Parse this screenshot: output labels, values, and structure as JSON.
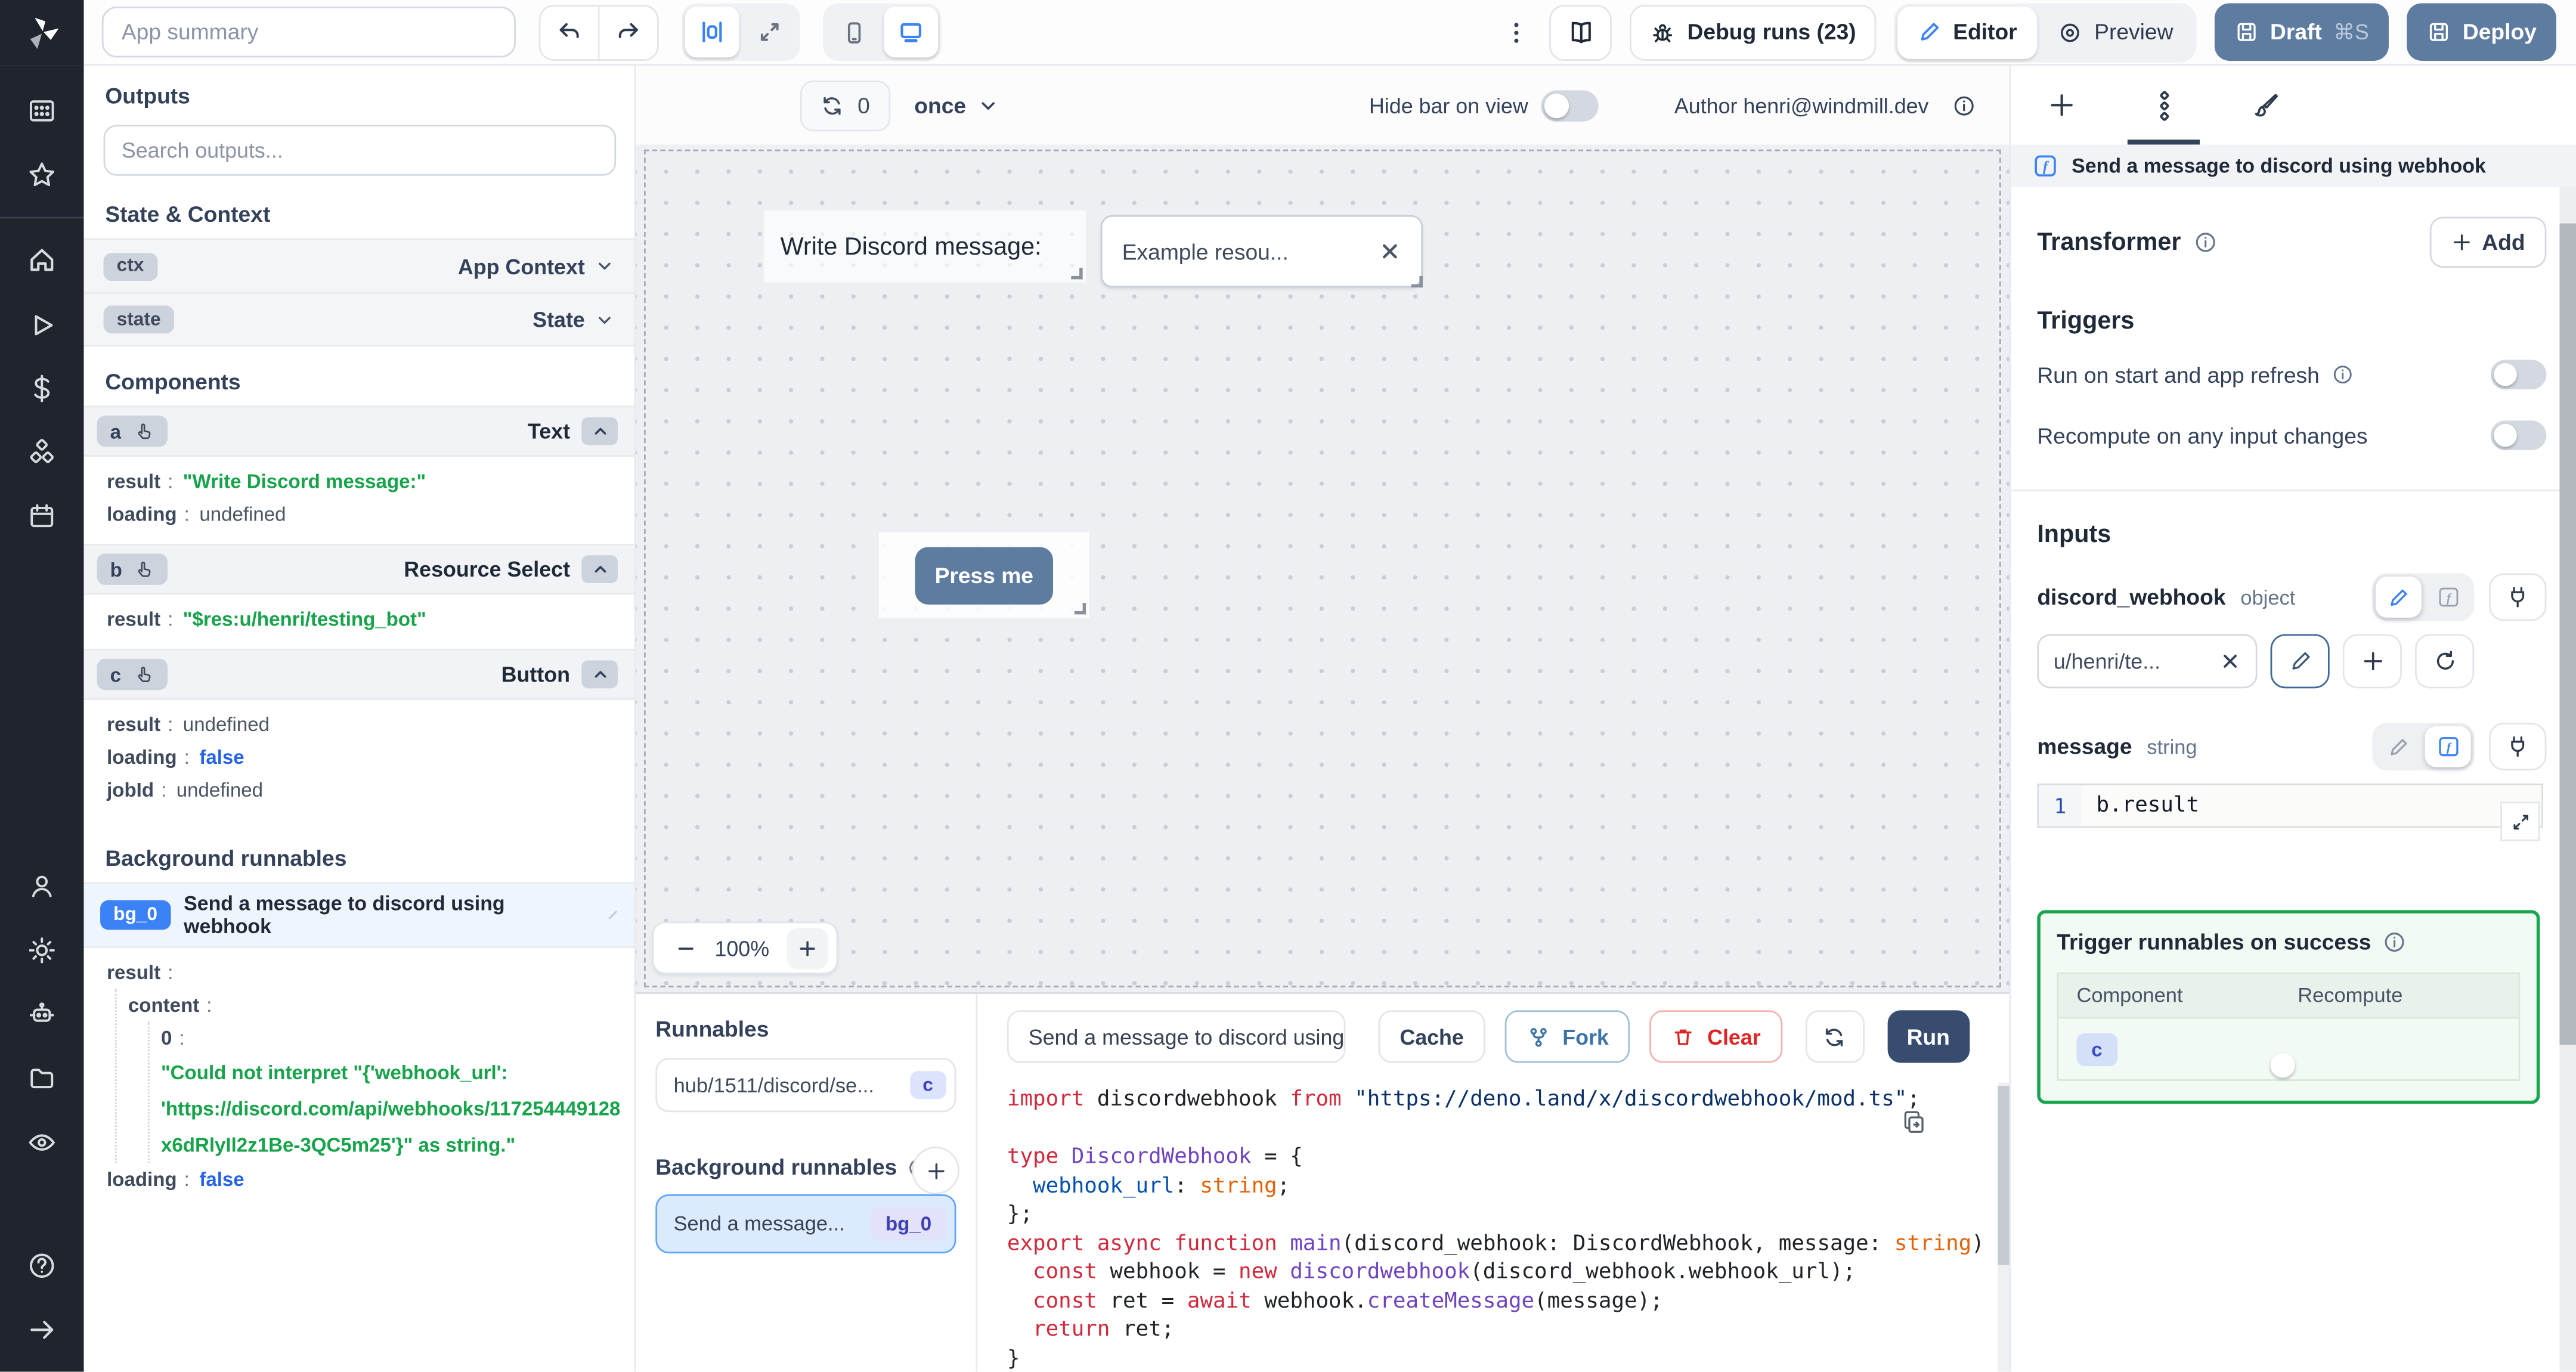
{
  "topbar": {
    "app_summary_placeholder": "App summary",
    "debug_runs_label": "Debug runs (23)",
    "editor_label": "Editor",
    "preview_label": "Preview",
    "draft_label": "Draft",
    "draft_shortcut": "⌘S",
    "deploy_label": "Deploy"
  },
  "outputs_panel": {
    "title": "Outputs",
    "search_placeholder": "Search outputs...",
    "state_context_title": "State & Context",
    "ctx_badge": "ctx",
    "ctx_label": "App Context",
    "state_badge": "state",
    "state_label": "State",
    "components_title": "Components",
    "components": [
      {
        "id": "a",
        "type": "Text",
        "rows": [
          {
            "k": "result",
            "v": "\"Write Discord message:\""
          },
          {
            "k": "loading",
            "v": "undefined"
          }
        ]
      },
      {
        "id": "b",
        "type": "Resource Select",
        "rows": [
          {
            "k": "result",
            "v": "\"$res:u/henri/testing_bot\""
          }
        ]
      },
      {
        "id": "c",
        "type": "Button",
        "rows": [
          {
            "k": "result",
            "v": "undefined"
          },
          {
            "k": "loading",
            "v": "false"
          },
          {
            "k": "jobId",
            "v": "undefined"
          }
        ]
      }
    ],
    "background_title": "Background runnables",
    "bg_badge": "bg_0",
    "bg_title": "Send a message to discord using webhook",
    "bg_result_key": "result",
    "bg_content_key": "content",
    "bg_index_key": "0",
    "bg_error_lines": [
      "\"Could not interpret \"{'webhook_url':",
      "'https://discord.com/api/webhooks/117254449128",
      "x6dRlyIl2z1Be-3QC5m25'}\" as string.\""
    ],
    "bg_loading_key": "loading",
    "bg_loading_value": "false"
  },
  "canvas": {
    "refresh_count": "0",
    "run_mode": "once",
    "hide_bar_label": "Hide bar on view",
    "author_label": "Author henri@windmill.dev",
    "text_component": "Write Discord message:",
    "select_value": "Example resou...",
    "button_label": "Press me",
    "zoom_level": "100%"
  },
  "runnables_panel": {
    "title": "Runnables",
    "hub_item_label": "hub/1511/discord/se...",
    "hub_item_badge": "c",
    "background_title": "Background runnables",
    "bg_item_label": "Send a message...",
    "bg_item_badge": "bg_0"
  },
  "editor_panel": {
    "tab_label": "Send a message to discord using",
    "cache_label": "Cache",
    "fork_label": "Fork",
    "clear_label": "Clear",
    "run_label": "Run",
    "lines": [
      [
        [
          "import",
          "k"
        ],
        [
          " discordwebhook ",
          "t"
        ],
        [
          "from",
          "k"
        ],
        [
          " ",
          "t"
        ],
        [
          "\"https://deno.land/x/discordwebhook/mod.ts\"",
          "s"
        ],
        [
          ";",
          "t"
        ]
      ],
      [],
      [
        [
          "type",
          "k"
        ],
        [
          " ",
          "t"
        ],
        [
          "DiscordWebhook",
          "p"
        ],
        [
          " = {",
          "t"
        ]
      ],
      [
        [
          "  ",
          "t"
        ],
        [
          "webhook_url",
          "b"
        ],
        [
          ": ",
          "t"
        ],
        [
          "string",
          "o"
        ],
        [
          ";",
          "t"
        ]
      ],
      [
        [
          "};",
          "t"
        ]
      ],
      [
        [
          "export",
          "k"
        ],
        [
          " ",
          "t"
        ],
        [
          "async",
          "k"
        ],
        [
          " ",
          "t"
        ],
        [
          "function",
          "k"
        ],
        [
          " ",
          "t"
        ],
        [
          "main",
          "p"
        ],
        [
          "(discord_webhook: DiscordWebhook, message: ",
          "t"
        ],
        [
          "string",
          "o"
        ],
        [
          ") {",
          "t"
        ]
      ],
      [
        [
          "  ",
          "t"
        ],
        [
          "const",
          "k"
        ],
        [
          " webhook = ",
          "t"
        ],
        [
          "new",
          "k"
        ],
        [
          " ",
          "t"
        ],
        [
          "discordwebhook",
          "p"
        ],
        [
          "(discord_webhook.webhook_url);",
          "t"
        ]
      ],
      [
        [
          "  ",
          "t"
        ],
        [
          "const",
          "k"
        ],
        [
          " ret = ",
          "t"
        ],
        [
          "await",
          "k"
        ],
        [
          " webhook.",
          "t"
        ],
        [
          "createMessage",
          "p"
        ],
        [
          "(message);",
          "t"
        ]
      ],
      [
        [
          "  ",
          "t"
        ],
        [
          "return",
          "k"
        ],
        [
          " ret;",
          "t"
        ]
      ],
      [
        [
          "}",
          "t"
        ]
      ]
    ]
  },
  "inspector": {
    "header_title": "Send a message to discord using webhook",
    "transformer_title": "Transformer",
    "add_label": "Add",
    "triggers_title": "Triggers",
    "trigger_run_on_start": "Run on start and app refresh",
    "trigger_recompute": "Recompute on any input changes",
    "inputs_title": "Inputs",
    "input1_name": "discord_webhook",
    "input1_type": "object",
    "input1_value": "u/henri/te...",
    "input2_name": "message",
    "input2_type": "string",
    "code_line_number": "1",
    "code_value": "b.result",
    "success_title": "Trigger runnables on success",
    "success_col_component": "Component",
    "success_col_recompute": "Recompute",
    "success_row_badge": "c"
  },
  "colors": {
    "accent_blue": "#3b82f6",
    "slate_button": "#5e7ca0",
    "run_navy": "#384c70",
    "success_green": "#16a34a",
    "value_green": "#16a34a",
    "value_blue": "#2563eb",
    "sidebar_dark": "#1f242d"
  }
}
